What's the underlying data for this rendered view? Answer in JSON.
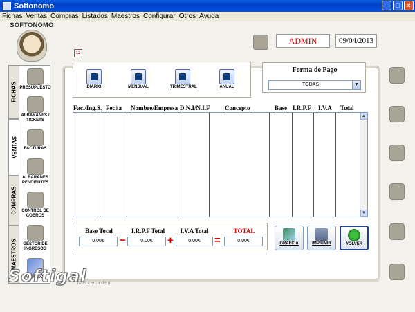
{
  "window": {
    "title": "Softonomo"
  },
  "menu": [
    "Fichas",
    "Ventas",
    "Compras",
    "Listados",
    "Maestros",
    "Configurar",
    "Otros",
    "Ayuda"
  ],
  "logo": {
    "text": "SOFTONOMO"
  },
  "header": {
    "user": "ADMIN",
    "date": "09/04/2013"
  },
  "side_tabs": [
    "FICHAS",
    "VENTAS",
    "COMPRAS",
    "MAESTROS"
  ],
  "nav_items": [
    {
      "label": "PRESUPUESTO",
      "icon": "budget-icon"
    },
    {
      "label": "ALBARANES / TICKETS",
      "icon": "delivery-note-icon"
    },
    {
      "label": "FACTURAS",
      "icon": "invoice-icon"
    },
    {
      "label": "ALBARANES PENDIENTES",
      "icon": "pending-notes-icon"
    },
    {
      "label": "CONTROL DE COBROS",
      "icon": "collections-icon"
    },
    {
      "label": "GESTOR DE INGRESOS",
      "icon": "income-manager-icon"
    },
    {
      "label": "INGRESOS",
      "icon": "income-icon"
    }
  ],
  "calendar_icon_text": "12",
  "period_buttons": [
    {
      "label": "DIARIO",
      "icon": "daily-icon"
    },
    {
      "label": "MENSUAL",
      "icon": "monthly-icon"
    },
    {
      "label": "TRIMESTRAL",
      "icon": "quarterly-icon"
    },
    {
      "label": "ANUAL",
      "icon": "annual-icon"
    }
  ],
  "forma_pago": {
    "title": "Forma de Pago",
    "selected": "TODAS"
  },
  "table": {
    "columns": [
      "Fac./Ing.S.",
      "Fecha",
      "Nombre/Empresa",
      "D.N.I/N.I.F",
      "Concepto",
      "Base",
      "I.R.P.F",
      "I.V.A",
      "Total"
    ],
    "rows": []
  },
  "totals": {
    "base_label": "Base Total",
    "base_value": "0.00€",
    "irpf_label": "I.R.P.F Total",
    "irpf_value": "0.00€",
    "iva_label": "I.V.A Total",
    "iva_value": "0.00€",
    "total_label": "TOTAL",
    "total_value": "0.00€",
    "op_minus": "−",
    "op_plus": "+",
    "op_equals": "="
  },
  "action_buttons": [
    {
      "label": "GRAFICA",
      "icon": "chart-icon",
      "color": "#3a8a5a"
    },
    {
      "label": "IMPRIMIR",
      "icon": "printer-icon",
      "color": "#5a6a8a"
    },
    {
      "label": "VOLVER",
      "icon": "exit-runner-icon",
      "color": "#2f9a2f"
    }
  ],
  "brand": {
    "name": "Softigal",
    "tagline": "más cerca de ti"
  }
}
